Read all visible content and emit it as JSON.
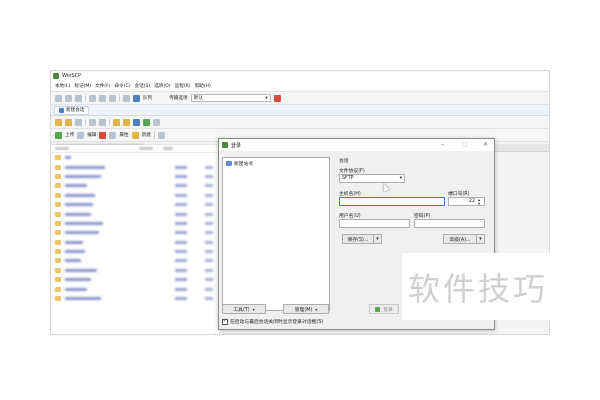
{
  "app": {
    "title": "WinSCP"
  },
  "menu": [
    "本地(L)",
    "标记(M)",
    "文件(F)",
    "命令(C)",
    "会话(S)",
    "选项(O)",
    "远程(R)",
    "帮助(H)"
  ],
  "toolbar": {
    "queue_label": "队列",
    "transfer_label": "传输选项",
    "transfer_value": "默认"
  },
  "tab": {
    "label": "新建会话"
  },
  "toolbar2": {
    "upload": "上传",
    "edit": "编辑",
    "properties": "属性",
    "new": "新建"
  },
  "dialog": {
    "title": "登录",
    "site_new": "新建站点",
    "section": "会话",
    "protocol_label": "文件协议(F)",
    "protocol_value": "SFTP",
    "host_label": "主机名(H)",
    "port_label": "端口号(R)",
    "port_value": "22",
    "user_label": "用户名(U)",
    "pass_label": "密码(P)",
    "save_button": "保存(S)...",
    "advanced_button": "高级(A)...",
    "tools_button": "工具(T)",
    "manage_button": "管理(M)",
    "login_button": "登录",
    "checkbox_label": "在启动与最后会话关闭时显示登录对话框(S)",
    "checkbox_checked": true
  },
  "watermark": {
    "text": "软件技巧"
  }
}
